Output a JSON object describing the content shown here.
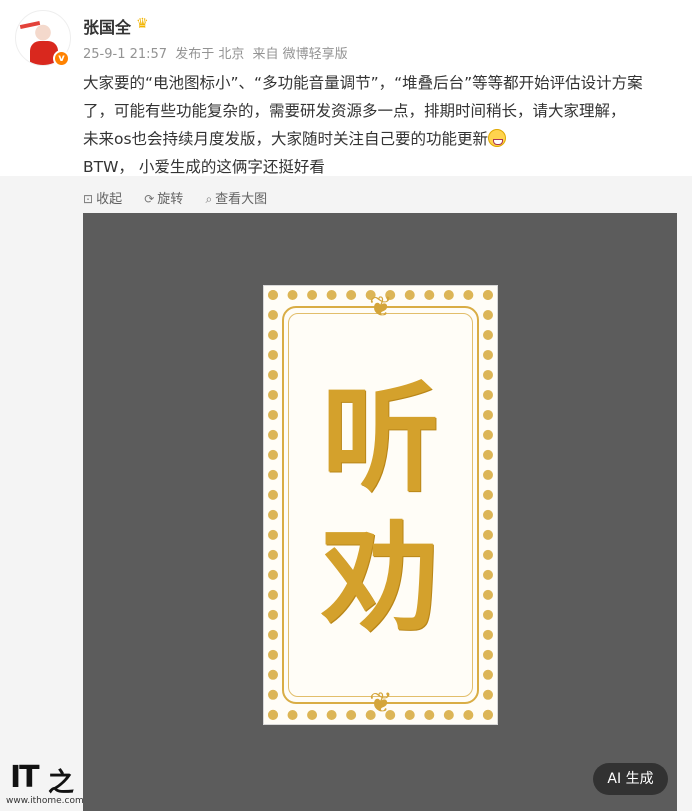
{
  "user": {
    "name": "张国全",
    "verified_icon": "verified-badge-icon",
    "crown_icon": "crown-icon",
    "meta": {
      "time": "25-9-1 21:57",
      "location": "发布于 北京",
      "source": "来自 微博轻享版"
    }
  },
  "post": {
    "lines": [
      "大家要的“电池图标小”、“多功能音量调节”，“堆叠后台”等等都开始评估设计方案",
      "了，可能有些功能复杂的，需要研发资源多一点，排期时间稍长，请大家理解，",
      "未来os也会持续月度发版，大家随时关注自己要的功能更新",
      "BTW， 小爱生成的这俩字还挺好看"
    ],
    "emoji_icon": "grin-emoji-icon"
  },
  "toolbar": {
    "collapse": "收起",
    "rotate": "旋转",
    "view_large": "查看大图"
  },
  "image": {
    "char1": "听",
    "char2": "劝",
    "ai_badge": "AI 生成",
    "watermark_logo": "IT之家",
    "watermark_url": "www.ithome.com"
  },
  "colors": {
    "gold": "#d4a12c",
    "image_bg": "#5c5c5c",
    "meta_gray": "#939393"
  }
}
